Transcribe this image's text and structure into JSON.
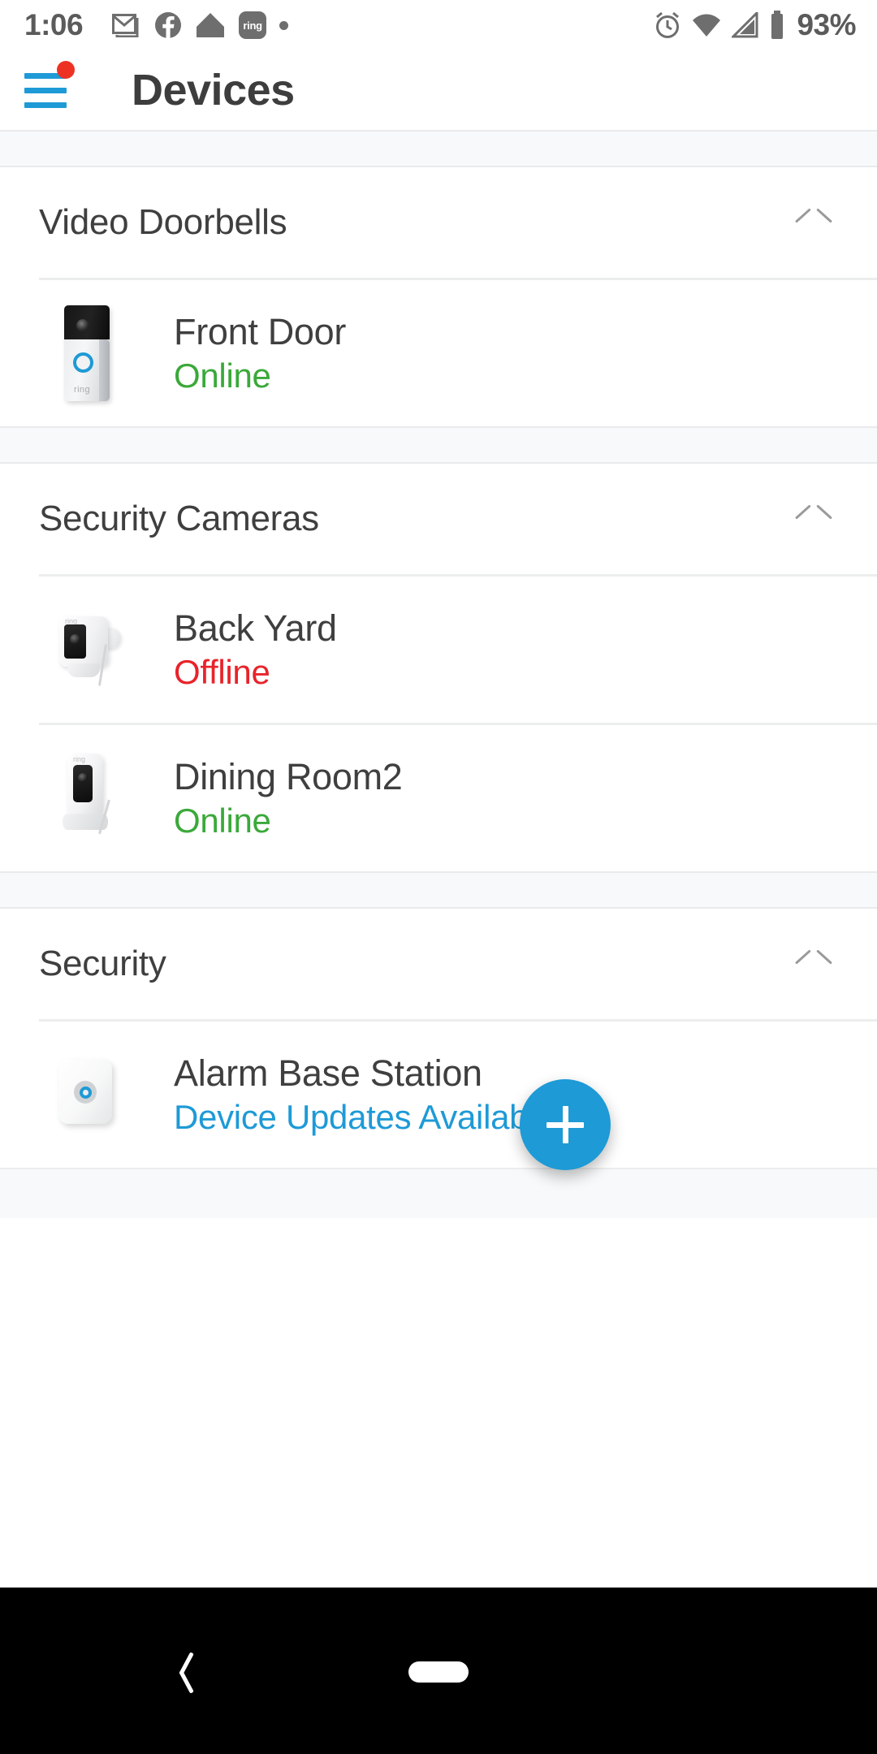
{
  "status_bar": {
    "time": "1:06",
    "battery_percent": "93%",
    "left_icons": [
      "gmail-icon",
      "facebook-icon",
      "nest-home-icon",
      "ring-icon",
      "dot-icon"
    ],
    "right_icons": [
      "alarm-clock-icon",
      "wifi-icon",
      "cell-signal-icon",
      "battery-icon"
    ],
    "ring_chip_label": "ring"
  },
  "app_bar": {
    "title": "Devices",
    "menu_icon": "hamburger-menu-icon",
    "menu_has_badge": true,
    "accent_color": "#1e9ad6",
    "badge_color": "#ed3224"
  },
  "sections": [
    {
      "title": "Video Doorbells",
      "collapse_icon": "chevron-up-icon",
      "devices": [
        {
          "name": "Front Door",
          "status": "Online",
          "status_type": "online",
          "thumb": "ring-video-doorbell"
        }
      ]
    },
    {
      "title": "Security Cameras",
      "collapse_icon": "chevron-up-icon",
      "devices": [
        {
          "name": "Back Yard",
          "status": "Offline",
          "status_type": "offline",
          "thumb": "ring-spotlight-cam"
        },
        {
          "name": "Dining Room2",
          "status": "Online",
          "status_type": "online",
          "thumb": "ring-stick-up-cam"
        }
      ]
    },
    {
      "title": "Security",
      "collapse_icon": "chevron-up-icon",
      "devices": [
        {
          "name": "Alarm Base Station",
          "status": "Device Updates Available",
          "status_type": "update",
          "thumb": "ring-alarm-base-station"
        }
      ]
    }
  ],
  "fab": {
    "icon": "plus-icon",
    "label": "+",
    "color": "#1e9ad6"
  },
  "nav_bar": {
    "back_icon": "back-chevron-icon",
    "home_icon": "home-pill-icon"
  },
  "status_colors": {
    "online": "#3aa93a",
    "offline": "#e8232a",
    "update": "#1e9ad6"
  }
}
